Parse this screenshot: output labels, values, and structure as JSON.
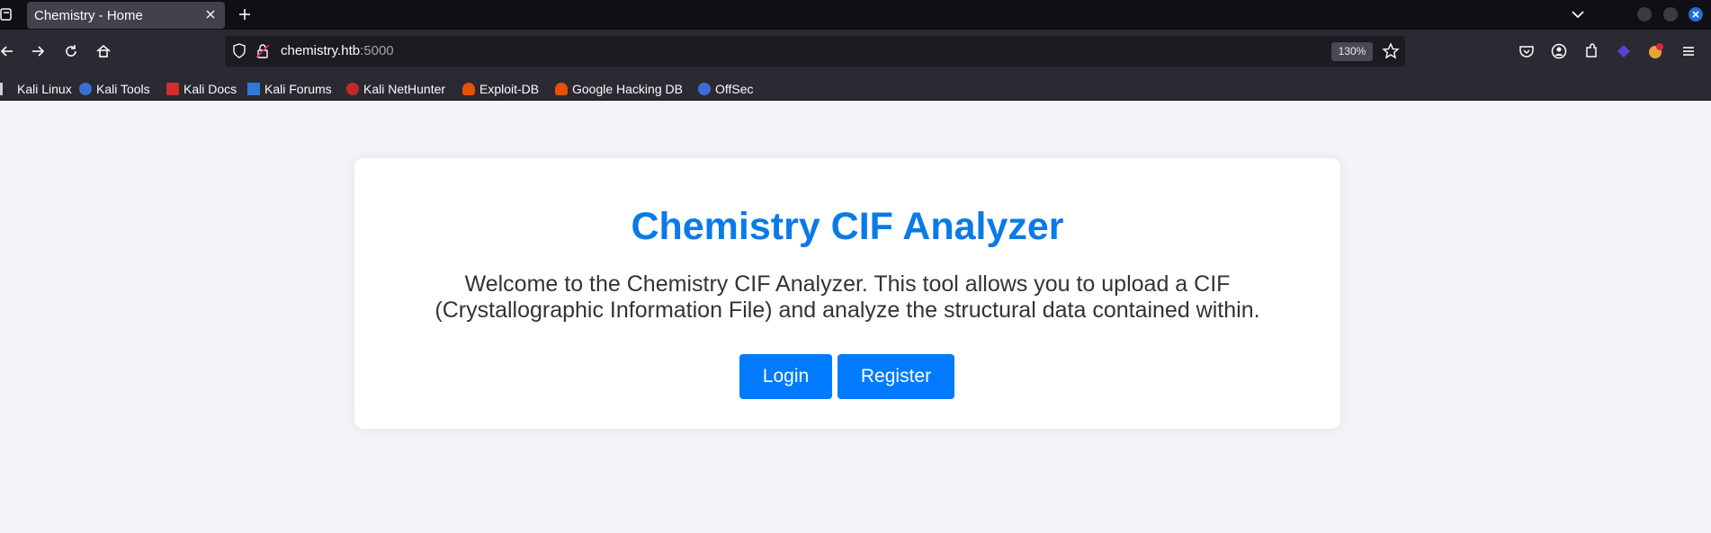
{
  "browser": {
    "tab_title": "Chemistry - Home",
    "url_host": "chemistry.htb",
    "url_port": ":5000",
    "zoom": "130%",
    "bookmarks": [
      {
        "label": "Kali Linux",
        "icon": "kali-linux-icon"
      },
      {
        "label": "Kali Tools",
        "icon": "kali-tools-icon"
      },
      {
        "label": "Kali Docs",
        "icon": "kali-docs-icon"
      },
      {
        "label": "Kali Forums",
        "icon": "kali-forums-icon"
      },
      {
        "label": "Kali NetHunter",
        "icon": "kali-nethunter-icon"
      },
      {
        "label": "Exploit-DB",
        "icon": "exploit-db-icon"
      },
      {
        "label": "Google Hacking DB",
        "icon": "ghdb-icon"
      },
      {
        "label": "OffSec",
        "icon": "offsec-icon"
      }
    ]
  },
  "page": {
    "title": "Chemistry CIF Analyzer",
    "description": "Welcome to the Chemistry CIF Analyzer. This tool allows you to upload a CIF (Crystallographic Information File) and analyze the structural data contained within.",
    "login_label": "Login",
    "register_label": "Register"
  },
  "colors": {
    "accent": "#007bff",
    "title": "#0a7ae6",
    "background": "#f4f4f8"
  }
}
